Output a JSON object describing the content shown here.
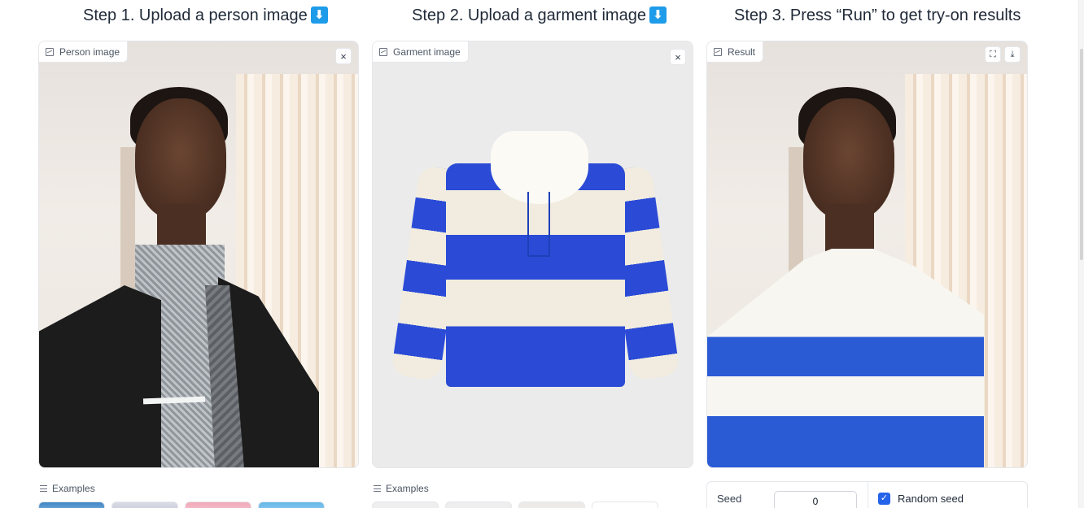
{
  "steps": {
    "step1_title": "Step 1. Upload a person image",
    "step2_title": "Step 2. Upload a garment image",
    "step3_title": "Step 3. Press “Run” to get try-on results",
    "arrow_glyph": "⬇"
  },
  "person_panel": {
    "label": "Person image",
    "close": "×",
    "icon": "image-icon",
    "close_icon": "close-icon"
  },
  "garment_panel": {
    "label": "Garment image",
    "close": "×",
    "icon": "image-icon",
    "close_icon": "close-icon"
  },
  "result_panel": {
    "label": "Result",
    "icon": "image-icon",
    "fullscreen_icon": "fullscreen-icon",
    "download_icon": "download-icon",
    "fullscreen": "⛶",
    "download": "⤓"
  },
  "examples": {
    "person_label": "Examples",
    "garment_label": "Examples",
    "icon": "list-icon"
  },
  "settings": {
    "seed_label": "Seed",
    "seed_value": "0",
    "random_seed_label": "Random seed",
    "random_seed_checked": true,
    "check_glyph": "✓"
  },
  "colors": {
    "accent": "#2563eb",
    "emoji_blue": "#1e9be9",
    "stripe_blue": "#2b4bd6",
    "stripe_cream": "#f1ecdf"
  }
}
